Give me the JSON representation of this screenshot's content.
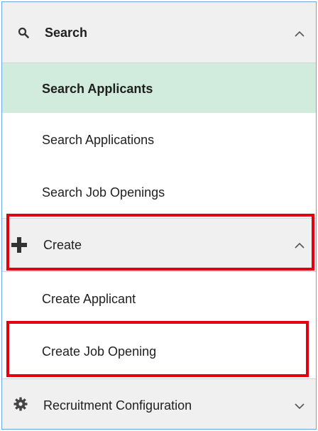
{
  "nav": {
    "search_section": {
      "label": "Search",
      "icon": "search-icon",
      "state": "expanded"
    },
    "search_items": [
      "Search Applicants",
      "Search Applications",
      "Search Job Openings"
    ],
    "create_section": {
      "label": "Create",
      "icon": "plus-icon",
      "state": "expanded"
    },
    "create_items": [
      "Create Applicant",
      "Create Job Opening"
    ],
    "config_section": {
      "label": "Recruitment Configuration",
      "icon": "gear-icon",
      "state": "collapsed"
    }
  },
  "colors": {
    "selected_bg": "#d1ebdc",
    "header_bg": "#f0f0f0",
    "highlight_border": "#e0000f",
    "panel_border": "#6aa6e6"
  }
}
